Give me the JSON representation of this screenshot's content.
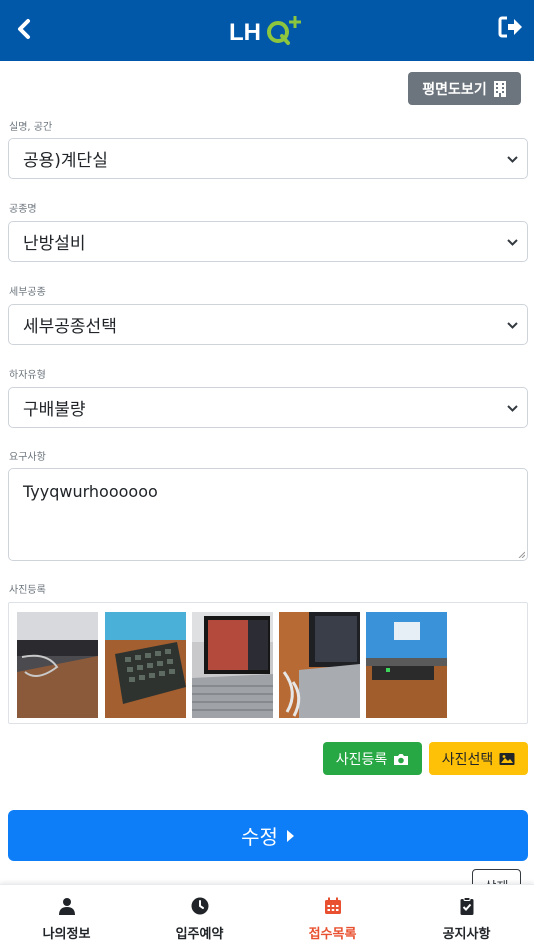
{
  "header": {
    "logo_text": "LHQ",
    "logo_plus": "+",
    "back_icon": "chevron-left-icon",
    "logout_icon": "sign-out-icon"
  },
  "plan_button": {
    "label": "평면도보기",
    "icon": "building-icon"
  },
  "fields": {
    "room": {
      "label": "실명, 공간",
      "value": "공용)계단실"
    },
    "work_type": {
      "label": "공종명",
      "value": "난방설비"
    },
    "sub_work_type": {
      "label": "세부공종",
      "value": "세부공종선택"
    },
    "defect_type": {
      "label": "하자유형",
      "value": "구배불량"
    },
    "request": {
      "label": "요구사항",
      "value": "Tyyqwurhoooooo"
    }
  },
  "photos": {
    "label": "사진등록",
    "items": [
      {
        "alt": "photo-1"
      },
      {
        "alt": "photo-2"
      },
      {
        "alt": "photo-3"
      },
      {
        "alt": "photo-4"
      },
      {
        "alt": "photo-5"
      }
    ],
    "upload_label": "사진등록",
    "select_label": "사진선택"
  },
  "submit_label": "수정",
  "delete_label": "삭제",
  "tabs": [
    {
      "label": "나의정보",
      "icon": "user-icon",
      "active": false
    },
    {
      "label": "입주예약",
      "icon": "clock-icon",
      "active": false
    },
    {
      "label": "접수목록",
      "icon": "calendar-icon",
      "active": true
    },
    {
      "label": "공지사항",
      "icon": "clipboard-check-icon",
      "active": false
    }
  ],
  "colors": {
    "header": "#0157a8",
    "primary": "#0d7ef8",
    "success": "#28a745",
    "warning": "#ffc107",
    "active_tab": "#e8502f",
    "logo_green": "#8cc63f"
  }
}
